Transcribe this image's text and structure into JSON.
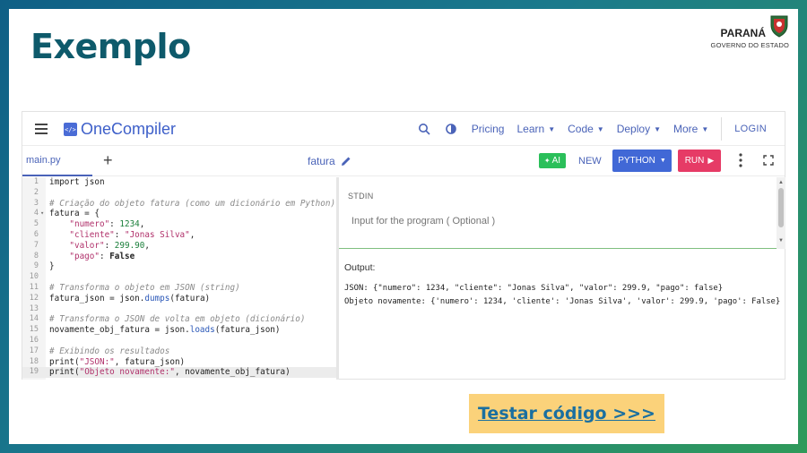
{
  "slide": {
    "title": "Exemplo",
    "logo": {
      "brand": "PARANÁ",
      "sub": "GOVERNO DO ESTADO"
    },
    "cta_label": "Testar código >>>"
  },
  "ide": {
    "brand": "OneCompiler",
    "brand_icon_text": "</>",
    "nav": {
      "pricing": "Pricing",
      "learn": "Learn",
      "code": "Code",
      "deploy": "Deploy",
      "more": "More",
      "login": "LOGIN"
    },
    "toolbar": {
      "tab": "main.py",
      "plus": "+",
      "file_name": "fatura",
      "ai": "AI",
      "new": "NEW",
      "language": "PYTHON",
      "run": "RUN"
    },
    "stdin": {
      "label": "STDIN",
      "placeholder": "Input for the program ( Optional )"
    },
    "output": {
      "label": "Output:",
      "line1": "JSON: {\"numero\": 1234, \"cliente\": \"Jonas Silva\", \"valor\": 299.9, \"pago\": false}",
      "line2": "Objeto novamente: {'numero': 1234, 'cliente': 'Jonas Silva', 'valor': 299.9, 'pago': False}"
    },
    "code_lines": [
      {
        "n": "1",
        "text": "import json"
      },
      {
        "n": "2",
        "text": ""
      },
      {
        "n": "3",
        "text": "# Criação do objeto fatura (como um dicionário em Python)"
      },
      {
        "n": "4",
        "text": "fatura = {"
      },
      {
        "n": "5",
        "text": "    \"numero\": 1234,"
      },
      {
        "n": "6",
        "text": "    \"cliente\": \"Jonas Silva\","
      },
      {
        "n": "7",
        "text": "    \"valor\": 299.90,"
      },
      {
        "n": "8",
        "text": "    \"pago\": False"
      },
      {
        "n": "9",
        "text": "}"
      },
      {
        "n": "10",
        "text": ""
      },
      {
        "n": "11",
        "text": "# Transforma o objeto em JSON (string)"
      },
      {
        "n": "12",
        "text": "fatura_json = json.dumps(fatura)"
      },
      {
        "n": "13",
        "text": ""
      },
      {
        "n": "14",
        "text": "# Transforma o JSON de volta em objeto (dicionário)"
      },
      {
        "n": "15",
        "text": "novamente_obj_fatura = json.loads(fatura_json)"
      },
      {
        "n": "16",
        "text": ""
      },
      {
        "n": "17",
        "text": "# Exibindo os resultados"
      },
      {
        "n": "18",
        "text": "print(\"JSON:\", fatura_json)"
      },
      {
        "n": "19",
        "text": "print(\"Objeto novamente:\", novamente_obj_fatura)"
      }
    ]
  },
  "colors": {
    "title": "#0e5a6b",
    "brand": "#3d5fc9",
    "python_button": "#4168d6",
    "run_button": "#e63b66",
    "ai_button": "#2bbf5a",
    "cta_background": "#fbd27a",
    "cta_text": "#1a6fa0"
  }
}
